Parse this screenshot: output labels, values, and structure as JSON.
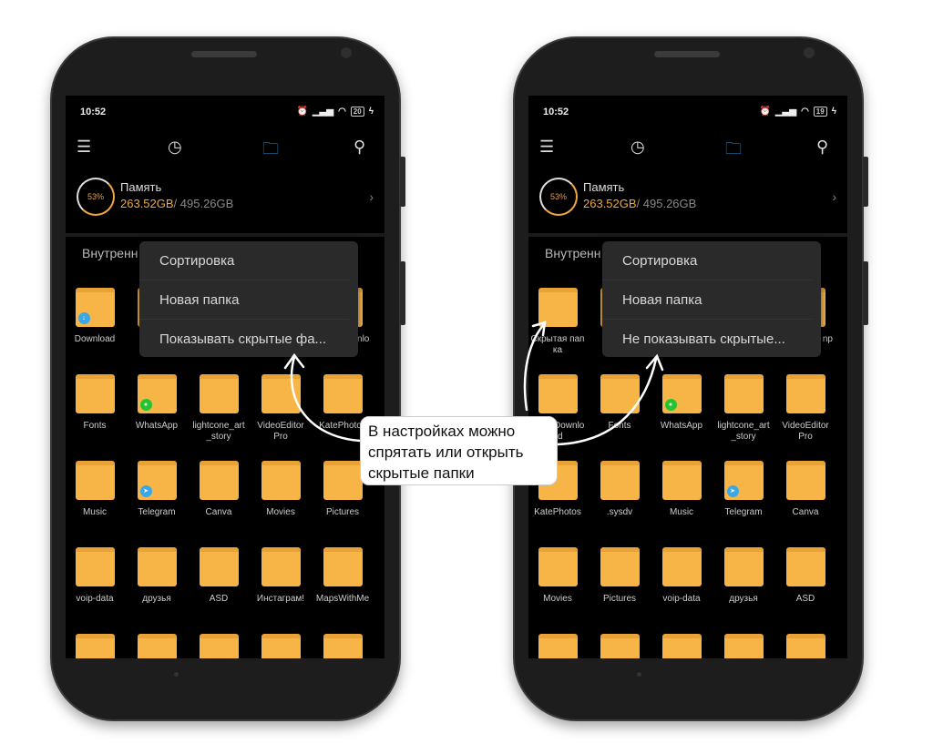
{
  "phones": [
    {
      "time": "10:52",
      "battery": "20",
      "tabs": [
        "menu-icon",
        "clock-icon",
        "folder-icon",
        "search-icon"
      ],
      "storage": {
        "percent": "53%",
        "title": "Память",
        "used": "263.52GB",
        "total": "/ 495.26GB"
      },
      "section": "Внутренн",
      "menu": [
        "Сортировка",
        "Новая папка",
        "Показывать скрытые фа..."
      ],
      "folders": [
        {
          "label": "Download",
          "badge": "download"
        },
        {
          "label": ""
        },
        {
          "label": ""
        },
        {
          "label": ""
        },
        {
          "label": "VideoDownload"
        },
        {
          "label": "Fonts"
        },
        {
          "label": "WhatsApp",
          "badge": "whatsapp"
        },
        {
          "label": "lightcone_art_story"
        },
        {
          "label": "VideoEditor Pro"
        },
        {
          "label": "KatePhotos"
        },
        {
          "label": "Music"
        },
        {
          "label": "Telegram",
          "badge": "telegram"
        },
        {
          "label": "Canva"
        },
        {
          "label": "Movies"
        },
        {
          "label": "Pictures"
        },
        {
          "label": "voip-data"
        },
        {
          "label": "друзья"
        },
        {
          "label": "ASD"
        },
        {
          "label": "Инстаграм!"
        },
        {
          "label": "MapsWithMe"
        },
        {
          "label": ""
        },
        {
          "label": ""
        },
        {
          "label": ""
        },
        {
          "label": ""
        },
        {
          "label": ""
        }
      ]
    },
    {
      "time": "10:52",
      "battery": "19",
      "tabs": [
        "menu-icon",
        "clock-icon",
        "folder-icon",
        "search-icon"
      ],
      "storage": {
        "percent": "53%",
        "title": "Память",
        "used": "263.52GB",
        "total": "/ 495.26GB"
      },
      "section": "Внутренн",
      "menu": [
        "Сортировка",
        "Новая папка",
        "Не показывать скрытые..."
      ],
      "folders": [
        {
          "label": "Скрытая папка"
        },
        {
          "label": ""
        },
        {
          "label": ""
        },
        {
          "label": ""
        },
        {
          "label": "np"
        },
        {
          "label": "VideoDownload"
        },
        {
          "label": "Fonts"
        },
        {
          "label": "WhatsApp",
          "badge": "whatsapp"
        },
        {
          "label": "lightcone_art_story"
        },
        {
          "label": "VideoEditor Pro"
        },
        {
          "label": "KatePhotos"
        },
        {
          "label": ".sysdv"
        },
        {
          "label": "Music"
        },
        {
          "label": "Telegram",
          "badge": "telegram"
        },
        {
          "label": "Canva"
        },
        {
          "label": "Movies"
        },
        {
          "label": "Pictures"
        },
        {
          "label": "voip-data"
        },
        {
          "label": "друзья"
        },
        {
          "label": "ASD"
        },
        {
          "label": ""
        },
        {
          "label": ""
        },
        {
          "label": ""
        },
        {
          "label": ""
        },
        {
          "label": ""
        }
      ]
    }
  ],
  "callout": "В настройках можно\nспрятать или открыть\nскрытые папки",
  "colors": {
    "accent": "#f0a83a",
    "folder": "#f7b548",
    "active_tab": "#2d8fd5",
    "whatsapp": "#25c430",
    "telegram": "#3aa7e6",
    "download": "#3aa7e6"
  }
}
